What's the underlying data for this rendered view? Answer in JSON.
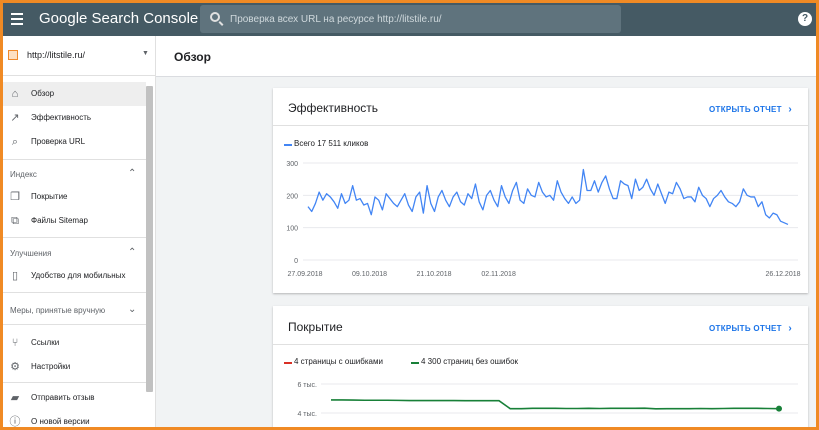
{
  "app": {
    "title": "Google Search Console"
  },
  "search": {
    "placeholder": "Проверка всех URL на ресурсе http://litstile.ru/",
    "value": ""
  },
  "help": {
    "icon": "help-icon",
    "label": "?"
  },
  "property": {
    "label": "http://litstile.ru/"
  },
  "nav": {
    "overview": "Обзор",
    "performance": "Эффективность",
    "url_inspection": "Проверка URL",
    "index_section": "Индекс",
    "coverage": "Покрытие",
    "sitemaps": "Файлы Sitemap",
    "enhancements_section": "Улучшения",
    "mobile": "Удобство для мобильных",
    "manual_section": "Меры, принятые вручную",
    "links": "Ссылки",
    "settings": "Настройки",
    "feedback": "Отправить отзыв",
    "about": "О новой версии"
  },
  "page": {
    "title": "Обзор"
  },
  "performance_card": {
    "title": "Эффективность",
    "link": "ОТКРЫТЬ ОТЧЕТ",
    "legend": "Всего 17 511 кликов",
    "color": "#4285f4"
  },
  "coverage_card": {
    "title": "Покрытие",
    "link": "ОТКРЫТЬ ОТЧЕТ",
    "legend_errors": "4 страницы с ошибками",
    "legend_valid": "4 300 страниц без ошибок",
    "error_color": "#d93025",
    "valid_color": "#188038"
  },
  "chart_data": [
    {
      "type": "line",
      "ylim": [
        0,
        300
      ],
      "yticks": [
        "300",
        "200",
        "100",
        "0"
      ],
      "xticks": [
        "27.09.2018",
        "09.10.2018",
        "21.10.2018",
        "02.11.2018",
        "26.12.2018"
      ],
      "grid": true,
      "series": [
        {
          "name": "Всего 17 511 кликов",
          "values": [
            165,
            150,
            175,
            210,
            185,
            205,
            195,
            180,
            160,
            205,
            175,
            185,
            230,
            185,
            190,
            170,
            175,
            140,
            195,
            185,
            155,
            205,
            190,
            175,
            165,
            185,
            205,
            170,
            150,
            195,
            210,
            145,
            230,
            175,
            150,
            195,
            215,
            185,
            165,
            195,
            210,
            180,
            170,
            205,
            190,
            235,
            180,
            155,
            200,
            215,
            185,
            165,
            230,
            195,
            175,
            215,
            240,
            185,
            175,
            220,
            200,
            195,
            240,
            210,
            195,
            200,
            185,
            245,
            210,
            190,
            175,
            195,
            175,
            185,
            280,
            215,
            215,
            245,
            210,
            240,
            260,
            220,
            190,
            190,
            245,
            235,
            230,
            190,
            250,
            215,
            225,
            250,
            220,
            200,
            235,
            205,
            175,
            210,
            205,
            240,
            220,
            190,
            195,
            195,
            180,
            225,
            200,
            190,
            165,
            190,
            200,
            215,
            195,
            180,
            175,
            165,
            180,
            220,
            200,
            195,
            195,
            165,
            180,
            140,
            130,
            145,
            140,
            120,
            115,
            110
          ]
        }
      ]
    },
    {
      "type": "line",
      "yticks": [
        "6 тыс.",
        "4 тыс."
      ],
      "series": [
        {
          "name": "4 страницы с ошибками",
          "values": []
        },
        {
          "name": "4 300 страниц без ошибок",
          "values": [
            4900,
            4900,
            4890,
            4880,
            4880,
            4880,
            4870,
            4860,
            4860,
            4860,
            4860,
            4860,
            4850,
            4850,
            4850,
            4850,
            4300,
            4300,
            4320,
            4320,
            4320,
            4310,
            4310,
            4320,
            4310,
            4320,
            4320,
            4320,
            4330,
            4290,
            4300,
            4300,
            4300,
            4310,
            4300,
            4310,
            4320,
            4320,
            4320,
            4310,
            4300
          ]
        }
      ]
    }
  ]
}
